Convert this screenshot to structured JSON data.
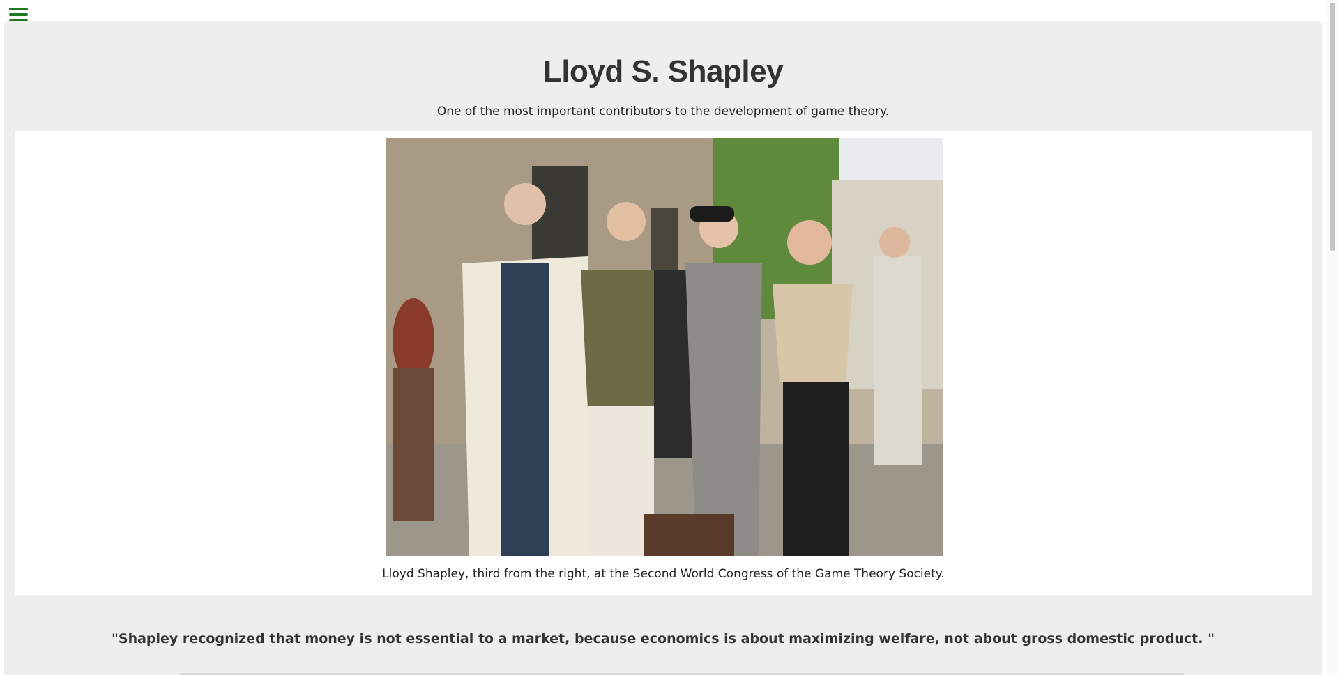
{
  "header": {
    "menu_icon": "hamburger-menu-icon",
    "accent_color": "#1f7a1f"
  },
  "main": {
    "title": "Lloyd S. Shapley",
    "subtitle": "One of the most important contributors to the development of game theory.",
    "figure": {
      "caption": "Lloyd Shapley, third from the right, at the Second World Congress of the Game Theory Society."
    },
    "quote": "\"Shapley recognized that money is not essential to a market, because economics is about maximizing welfare, not about gross domestic product. \""
  }
}
